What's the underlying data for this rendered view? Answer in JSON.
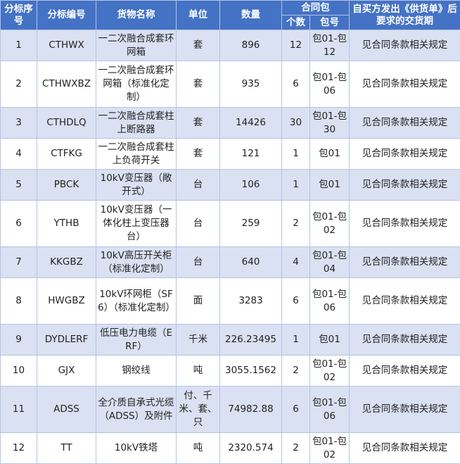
{
  "header": {
    "seq": "分标序号",
    "code": "分标编号",
    "goods": "货物名称",
    "unit": "单位",
    "qty": "数量",
    "contract_pkg": "合同包",
    "pkg_count": "个数",
    "pkg_no": "包号",
    "delivery": "自买方发出《供货单》后要求的交货期"
  },
  "rows": [
    {
      "seq": "1",
      "code": "CTHWX",
      "goods": "一二次融合成套环网箱",
      "unit": "套",
      "qty": "896",
      "count": "12",
      "pkg": "包01-包12",
      "delivery": "见合同条款相关规定"
    },
    {
      "seq": "2",
      "code": "CTHWXBZ",
      "goods": "一二次融合成套环网箱（标准化定制）",
      "unit": "套",
      "qty": "935",
      "count": "6",
      "pkg": "包01-包06",
      "delivery": "见合同条款相关规定"
    },
    {
      "seq": "3",
      "code": "CTHDLQ",
      "goods": "一二次融合成套柱上断路器",
      "unit": "套",
      "qty": "14426",
      "count": "30",
      "pkg": "包01-包30",
      "delivery": "见合同条款相关规定"
    },
    {
      "seq": "4",
      "code": "CTFKG",
      "goods": "一二次融合成套柱上负荷开关",
      "unit": "套",
      "qty": "121",
      "count": "1",
      "pkg": "包01",
      "delivery": "见合同条款相关规定"
    },
    {
      "seq": "5",
      "code": "PBCK",
      "goods": "10kV变压器（敞开式）",
      "unit": "台",
      "qty": "106",
      "count": "1",
      "pkg": "包01",
      "delivery": "见合同条款相关规定"
    },
    {
      "seq": "6",
      "code": "YTHB",
      "goods": "10kV变压器（一体化柱上变压器台）",
      "unit": "台",
      "qty": "259",
      "count": "2",
      "pkg": "包01-包02",
      "delivery": "见合同条款相关规定"
    },
    {
      "seq": "7",
      "code": "KKGBZ",
      "goods": "10kV高压开关柜（标准化定制）",
      "unit": "台",
      "qty": "640",
      "count": "4",
      "pkg": "包01-包04",
      "delivery": "见合同条款相关规定"
    },
    {
      "seq": "8",
      "code": "HWGBZ",
      "goods": "10kV环网柜（SF6）（标准化定制）",
      "unit": "面",
      "qty": "3283",
      "count": "6",
      "pkg": "包01-包06",
      "delivery": "见合同条款相关规定"
    },
    {
      "seq": "9",
      "code": "DYDLERF",
      "goods": "低压电力电缆（ERF）",
      "unit": "千米",
      "qty": "226.23495",
      "count": "1",
      "pkg": "包01",
      "delivery": "见合同条款相关规定"
    },
    {
      "seq": "10",
      "code": "GJX",
      "goods": "钢绞线",
      "unit": "吨",
      "qty": "3055.1562",
      "count": "2",
      "pkg": "包01-包02",
      "delivery": "见合同条款相关规定"
    },
    {
      "seq": "11",
      "code": "ADSS",
      "goods": "全介质自承式光缆（ADSS）及附件",
      "unit": "付、千米、套、只",
      "qty": "74982.88",
      "count": "6",
      "pkg": "包01-包06",
      "delivery": "见合同条款相关规定"
    },
    {
      "seq": "12",
      "code": "TT",
      "goods": "10kV铁塔",
      "unit": "吨",
      "qty": "2320.574",
      "count": "2",
      "pkg": "包01-包02",
      "delivery": "见合同条款相关规定"
    }
  ]
}
